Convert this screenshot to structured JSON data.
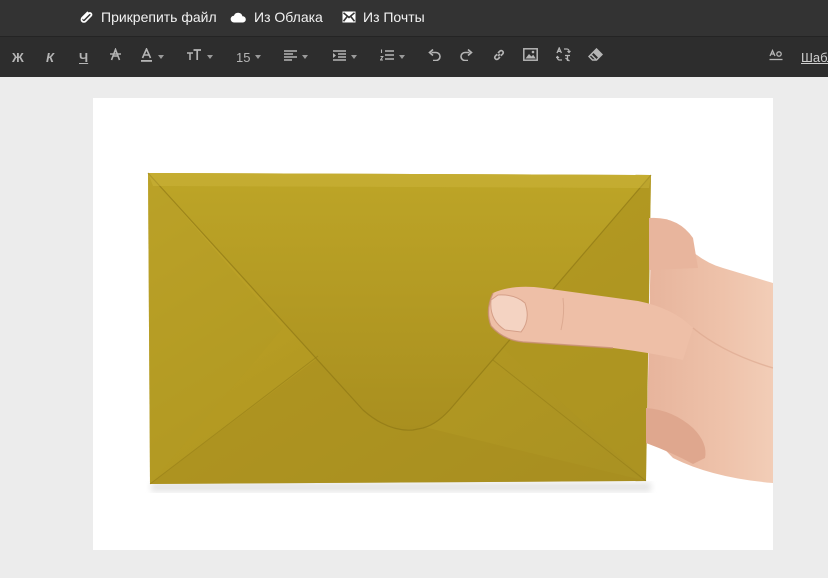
{
  "attachments": {
    "attach_file_label": "Прикрепить файл",
    "from_cloud_label": "Из Облака",
    "from_mail_label": "Из Почты"
  },
  "toolbar": {
    "bold_label": "Ж",
    "italic_label": "К",
    "underline_label": "Ч",
    "font_size_value": "15",
    "templates_label": "Шабл"
  },
  "image": {
    "description": "gold-envelope-held-in-hand",
    "envelope_color": "#b9a02a",
    "background_color": "#ffffff"
  },
  "colors": {
    "top_bar": "#333333",
    "toolbar": "#2d2d2d",
    "editor_bg": "#ececec",
    "icon": "#b5b5b5"
  }
}
